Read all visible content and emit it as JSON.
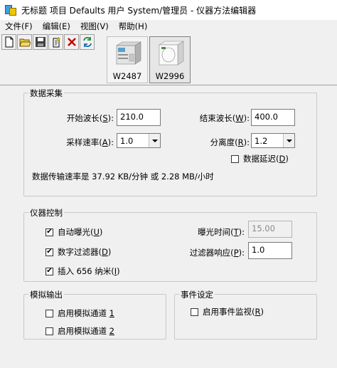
{
  "window": {
    "title": "无标题 项目 Defaults 用户 System/管理员 - 仪器方法编辑器"
  },
  "menu": [
    {
      "label": "文件(F)"
    },
    {
      "label": "编辑(E)"
    },
    {
      "label": "视图(V)"
    },
    {
      "label": "帮助(H)"
    }
  ],
  "toolbar_icons": [
    "new-file-icon",
    "open-folder-icon",
    "save-icon",
    "new-entry-icon",
    "delete-icon",
    "refresh-icon"
  ],
  "instruments": [
    {
      "label": "W2487",
      "icon": "detector-instrument-icon"
    },
    {
      "label": "W2996",
      "icon": "pda-instrument-icon"
    }
  ],
  "data_acquisition": {
    "title": "数据采集",
    "start_wavelength": {
      "label_pre": "开始波长(",
      "key": "S",
      "label_post": "):",
      "value": "210.0"
    },
    "end_wavelength": {
      "label_pre": "结束波长(",
      "key": "W",
      "label_post": "):",
      "value": "400.0"
    },
    "sampling_rate": {
      "label_pre": "采样速率(",
      "key": "A",
      "label_post": "):",
      "value": "1.0"
    },
    "resolution": {
      "label_pre": "分离度(",
      "key": "R",
      "label_post": "):",
      "value": "1.2"
    },
    "data_delay": {
      "label_pre": "数据延迟(",
      "key": "D",
      "label_post": ")",
      "checked": false
    },
    "transfer_rate": "数据传输速率是 37.92 KB/分钟 或 2.28 MB/小时"
  },
  "instrument_control": {
    "title": "仪器控制",
    "auto_exposure": {
      "label_pre": "自动曝光(",
      "key": "U",
      "label_post": ")",
      "checked": true
    },
    "digital_filter": {
      "label_pre": "数字过滤器(",
      "key": "D",
      "label_post": ")",
      "checked": true
    },
    "interpolate": {
      "label_pre": "插入 656 纳米(",
      "key": "I",
      "label_post": ")",
      "checked": true
    },
    "exposure_time": {
      "label_pre": "曝光时间(",
      "key": "T",
      "label_post": "):",
      "value": "15.00"
    },
    "filter_response": {
      "label_pre": "过滤器响应(",
      "key": "P",
      "label_post": "):",
      "value": "1.0"
    }
  },
  "analog_output": {
    "title": "模拟输出",
    "channel1": {
      "label_pre": "启用模拟通道 ",
      "key": "1",
      "checked": false
    },
    "channel2": {
      "label_pre": "启用模拟通道 ",
      "key": "2",
      "checked": false
    }
  },
  "event_settings": {
    "title": "事件设定",
    "event_monitor": {
      "label_pre": "启用事件监视(",
      "key": "R",
      "label_post": ")",
      "checked": false
    }
  },
  "check_glyph": "✔"
}
